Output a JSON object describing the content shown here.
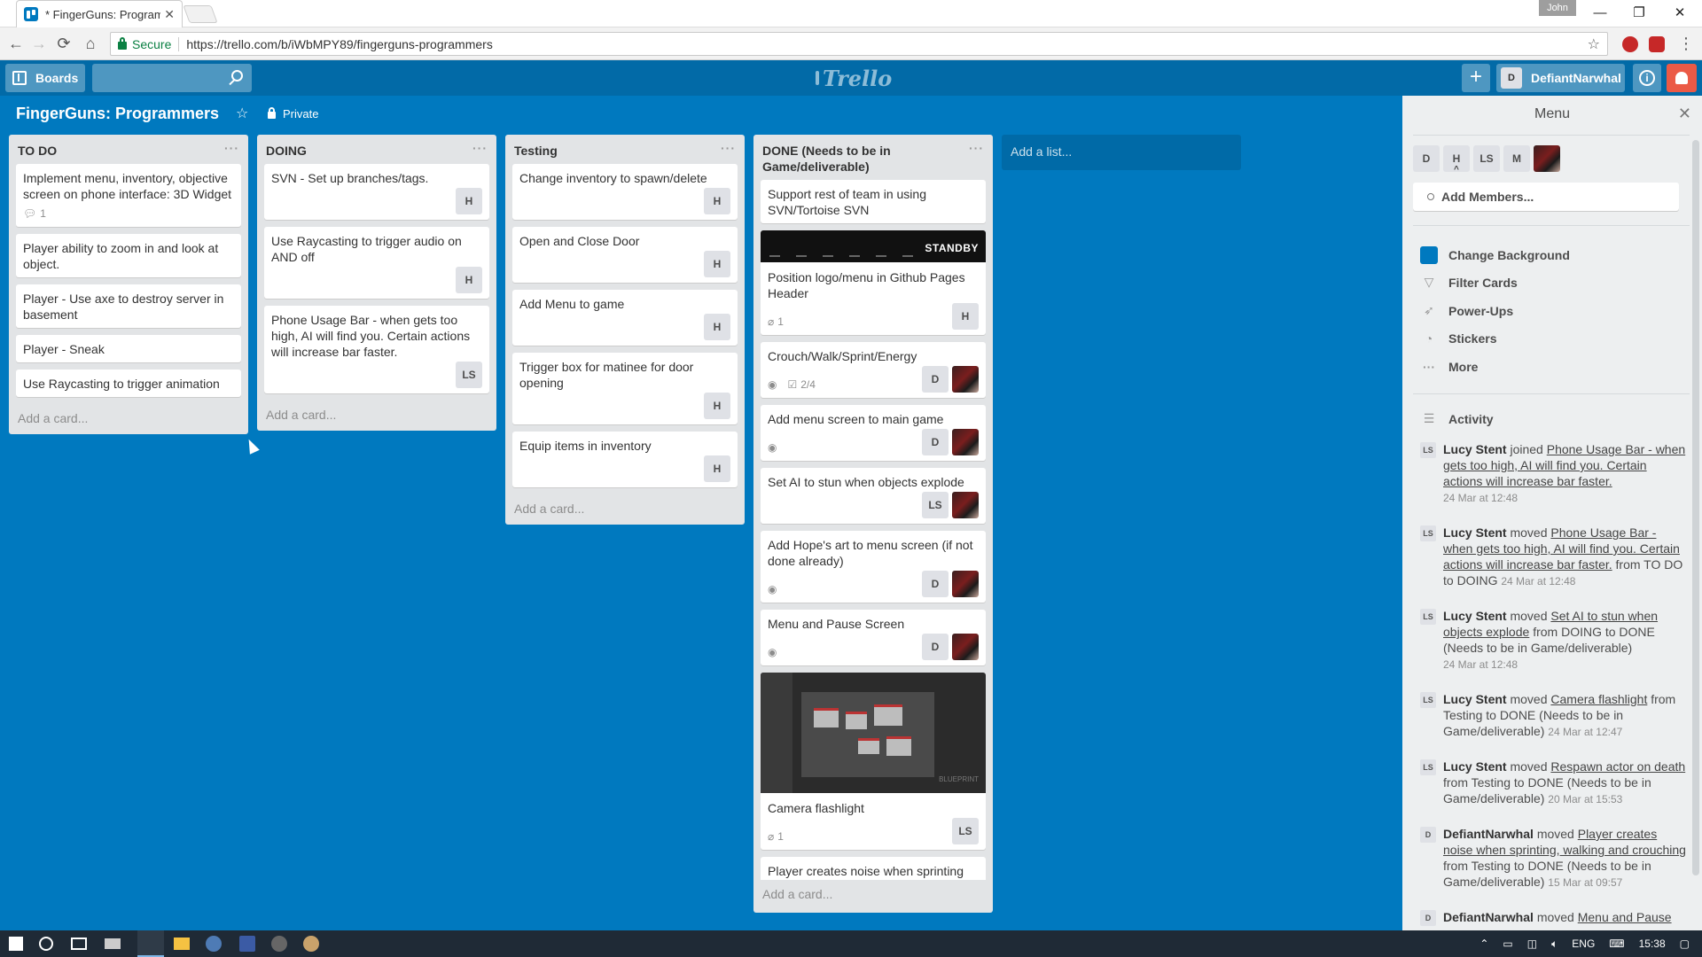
{
  "browser": {
    "tab_title": "* FingerGuns: Programm",
    "tab_close": "✕",
    "profile_name": "John",
    "secure_label": "Secure",
    "url": "https://trello.com/b/iWbMPY89/fingerguns-programmers",
    "icons": {
      "back": "←",
      "forward": "→",
      "reload": "⟳",
      "home": "⌂",
      "bookmark": "☆",
      "menu": "⋮",
      "minimize": "—",
      "restore": "❐",
      "close": "✕"
    }
  },
  "header": {
    "boards_label": "Boards",
    "add_icon": "+",
    "logo_text": "Trello",
    "user_initial": "D",
    "user_name": "DefiantNarwhal",
    "info_icon": "i"
  },
  "board": {
    "title": "FingerGuns: Programmers",
    "star_icon": "☆",
    "visibility": "Private"
  },
  "lists": [
    {
      "title": "TO DO",
      "add_card": "Add a card...",
      "cards": [
        {
          "title": "Implement menu, inventory, objective screen on phone interface: 3D Widget",
          "comments": "1"
        },
        {
          "title": "Player ability to zoom in and look at object."
        },
        {
          "title": "Player - Use axe to destroy server in basement"
        },
        {
          "title": "Player - Sneak"
        },
        {
          "title": "Use Raycasting to trigger animation"
        }
      ]
    },
    {
      "title": "DOING",
      "add_card": "Add a card...",
      "cards": [
        {
          "title": "SVN - Set up branches/tags.",
          "members": [
            "H"
          ]
        },
        {
          "title": "Use Raycasting to trigger audio on AND off",
          "members": [
            "H"
          ]
        },
        {
          "title": "Phone Usage Bar - when gets too high, AI will find you. Certain actions will increase bar faster.",
          "members": [
            "LS"
          ]
        }
      ]
    },
    {
      "title": "Testing",
      "add_card": "Add a card...",
      "cards": [
        {
          "title": "Change inventory to spawn/delete",
          "members": [
            "H"
          ]
        },
        {
          "title": "Open and Close Door",
          "members": [
            "H"
          ]
        },
        {
          "title": "Add Menu to game",
          "members": [
            "H"
          ]
        },
        {
          "title": "Trigger box for matinee for door opening",
          "members": [
            "H"
          ]
        },
        {
          "title": "Equip items in inventory",
          "members": [
            "H"
          ]
        }
      ]
    },
    {
      "title": "DONE (Needs to be in Game/deliverable)",
      "add_card": "Add a card...",
      "cards": [
        {
          "title": "Support rest of team in using SVN/Tortoise SVN"
        },
        {
          "title": "Position logo/menu in Github Pages Header",
          "cover_text": "STANDBY",
          "attachments": "1",
          "members": [
            "H"
          ]
        },
        {
          "title": "Crouch/Walk/Sprint/Energy",
          "checklist": "2/4",
          "members": [
            "D"
          ]
        },
        {
          "title": "Add menu screen to main game",
          "members": [
            "D"
          ]
        },
        {
          "title": "Set AI to stun when objects explode",
          "members": [
            "LS"
          ]
        },
        {
          "title": "Add Hope's art to menu screen (if not done already)",
          "members": [
            "D"
          ]
        },
        {
          "title": "Menu and Pause Screen",
          "members": [
            "D"
          ]
        },
        {
          "title": "Camera flashlight",
          "cover_label": "BLUEPRINT",
          "attachments": "1",
          "members": [
            "LS"
          ]
        },
        {
          "title": "Player creates noise when sprinting"
        }
      ]
    }
  ],
  "add_list": "Add a list...",
  "sidebar": {
    "title": "Menu",
    "close_icon": "✕",
    "members": [
      "D",
      "H",
      "LS",
      "M"
    ],
    "add_members": "Add Members...",
    "items": [
      {
        "label": "Change Background",
        "icon": "swatch"
      },
      {
        "label": "Filter Cards",
        "icon": "filter-icon"
      },
      {
        "label": "Power-Ups",
        "icon": "rocket-icon"
      },
      {
        "label": "Stickers",
        "icon": "sticker-icon"
      },
      {
        "label": "More",
        "icon": "ellipsis-icon"
      }
    ],
    "activity_title": "Activity",
    "activity": [
      {
        "avatar": "LS",
        "who": "Lucy Stent",
        "verb": "joined",
        "link": "Phone Usage Bar - when gets too high, AI will find you. Certain actions will increase bar faster.",
        "rest": "",
        "when": "24 Mar at 12:48"
      },
      {
        "avatar": "LS",
        "who": "Lucy Stent",
        "verb": "moved",
        "link": "Phone Usage Bar - when gets too high, AI will find you. Certain actions will increase bar faster.",
        "rest": "from TO DO to DOING",
        "when": "24 Mar at 12:48"
      },
      {
        "avatar": "LS",
        "who": "Lucy Stent",
        "verb": "moved",
        "link": "Set AI to stun when objects explode",
        "rest": "from DOING to DONE (Needs to be in Game/deliverable)",
        "when": "24 Mar at 12:48"
      },
      {
        "avatar": "LS",
        "who": "Lucy Stent",
        "verb": "moved",
        "link": "Camera flashlight",
        "rest": "from Testing to DONE (Needs to be in Game/deliverable)",
        "when": "24 Mar at 12:47"
      },
      {
        "avatar": "LS",
        "who": "Lucy Stent",
        "verb": "moved",
        "link": "Respawn actor on death",
        "rest": "from Testing to DONE (Needs to be in Game/deliverable)",
        "when": "20 Mar at 15:53"
      },
      {
        "avatar": "D",
        "who": "DefiantNarwhal",
        "verb": "moved",
        "link": "Player creates noise when sprinting, walking and crouching",
        "rest": "from Testing to DONE (Needs to be in Game/deliverable)",
        "when": "15 Mar at 09:57"
      },
      {
        "avatar": "D",
        "who": "DefiantNarwhal",
        "verb": "moved",
        "link": "Menu and Pause",
        "rest": "",
        "when": ""
      }
    ]
  },
  "taskbar": {
    "lang": "ENG",
    "time": "15:38"
  },
  "colors": {
    "board_bg": "#0079bf",
    "header_bg": "#026aa7",
    "list_bg": "#e2e4e6",
    "sidebar_bg": "#edeff0",
    "notification": "#eb5a46"
  }
}
